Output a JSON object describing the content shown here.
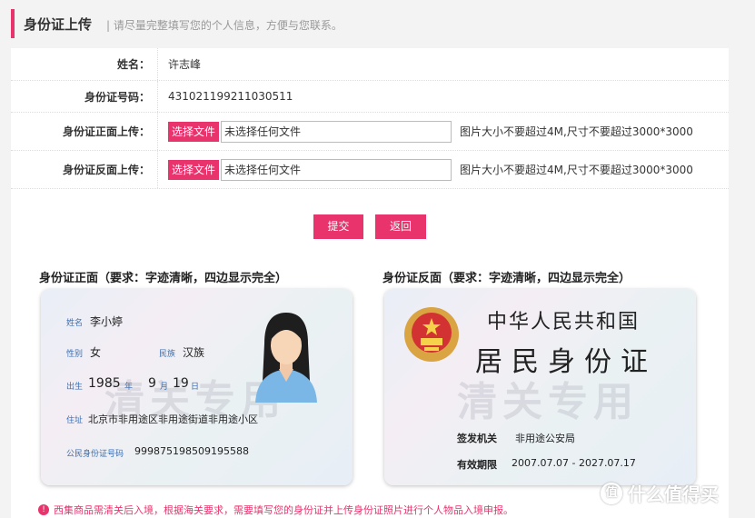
{
  "header": {
    "title": "身份证上传",
    "hint": "| 请尽量完整填写您的个人信息，方便与您联系。"
  },
  "form": {
    "name_label": "姓名：",
    "name_value": "许志峰",
    "id_label": "身份证号码：",
    "id_value": "431021199211030511",
    "front_label": "身份证正面上传：",
    "back_label": "身份证反面上传：",
    "choose_file": "选择文件",
    "no_file": "未选择任何文件",
    "file_note": "图片大小不要超过4M,尺寸不要超过3000*3000"
  },
  "buttons": {
    "submit": "提交",
    "back": "返回"
  },
  "samples": {
    "front_title": "身份证正面（要求：字迹清晰，四边显示完全）",
    "back_title": "身份证反面（要求：字迹清晰，四边显示完全）",
    "front": {
      "name_label": "姓名",
      "name": "李小婷",
      "gender_label": "性别",
      "gender": "女",
      "ethnic_label": "民族",
      "ethnic": "汉族",
      "birth_label": "出生",
      "year": "1985",
      "year_unit": "年",
      "month": "9",
      "month_unit": "月",
      "day": "19",
      "day_unit": "日",
      "address_label": "住址",
      "address": "北京市非用途区非用途街道非用途小区",
      "idno_label": "公民身份证号码",
      "idno": "999875198509195588",
      "watermark": "清关专用"
    },
    "back": {
      "country": "中华人民共和国",
      "card_name": "居民身份证",
      "authority_label": "签发机关",
      "authority": "非用途公安局",
      "valid_label": "有效期限",
      "valid": "2007.07.07 - 2027.07.17",
      "watermark": "清关专用"
    }
  },
  "notice": "西集商品需清关后入境，根据海关要求，需要填写您的身份证并上传身份证照片进行个人物品入境申报。",
  "logo": "什么值得买",
  "colors": {
    "accent": "#e8336d",
    "hint": "#999999"
  }
}
